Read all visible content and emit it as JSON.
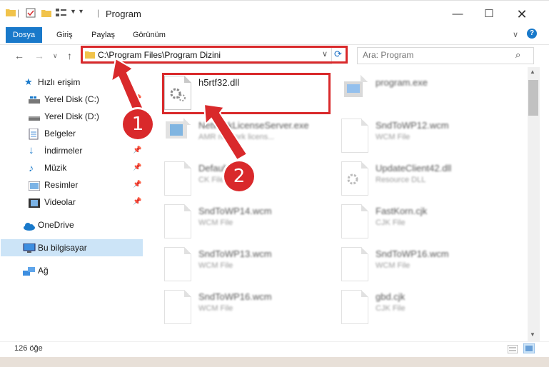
{
  "window": {
    "title": "Program"
  },
  "ribbon": {
    "tabs": [
      "Dosya",
      "Giriş",
      "Paylaş",
      "Görünüm"
    ]
  },
  "address": {
    "path": "C:\\Program Files\\Program Dizini"
  },
  "search": {
    "placeholder": "Ara: Program"
  },
  "sidebar": {
    "items": [
      {
        "label": "Hızlı erişim",
        "icon": "star-icon"
      },
      {
        "label": "Yerel Disk (C:)",
        "icon": "disk-icon"
      },
      {
        "label": "Yerel Disk (D:)",
        "icon": "disk-icon"
      },
      {
        "label": "Belgeler",
        "icon": "documents-icon"
      },
      {
        "label": "İndirmeler",
        "icon": "download-icon"
      },
      {
        "label": "Müzik",
        "icon": "music-icon"
      },
      {
        "label": "Resimler",
        "icon": "pictures-icon"
      },
      {
        "label": "Videolar",
        "icon": "videos-icon"
      },
      {
        "label": "OneDrive",
        "icon": "cloud-icon"
      },
      {
        "label": "Bu bilgisayar",
        "icon": "computer-icon"
      },
      {
        "label": "Ağ",
        "icon": "network-icon"
      }
    ]
  },
  "files": [
    {
      "name": "h5rtf32.dll",
      "type": ""
    },
    {
      "name": "program.exe",
      "type": ""
    },
    {
      "name": "NetworkLicenseServer.exe",
      "type": "AMR network licens..."
    },
    {
      "name": "SndToWP12.wcm",
      "type": "WCM File"
    },
    {
      "name": "DefaultL....ck",
      "type": "CK File"
    },
    {
      "name": "UpdateClient42.dll",
      "type": "Resource DLL"
    },
    {
      "name": "SndToWP14.wcm",
      "type": "WCM File"
    },
    {
      "name": "FastKorn.cjk",
      "type": "CJK File"
    },
    {
      "name": "SndToWP13.wcm",
      "type": "WCM File"
    },
    {
      "name": "SndToWP16.wcm",
      "type": "WCM File"
    },
    {
      "name": "SndToWP16.wcm",
      "type": "WCM File"
    },
    {
      "name": "gbd.cjk",
      "type": "CJK File"
    }
  ],
  "status": {
    "count": "126 öğe"
  },
  "annotations": {
    "step1": "1",
    "step2": "2"
  },
  "colors": {
    "accent": "#1979ca",
    "highlight": "#d9292b",
    "selection": "#cce4f7"
  }
}
